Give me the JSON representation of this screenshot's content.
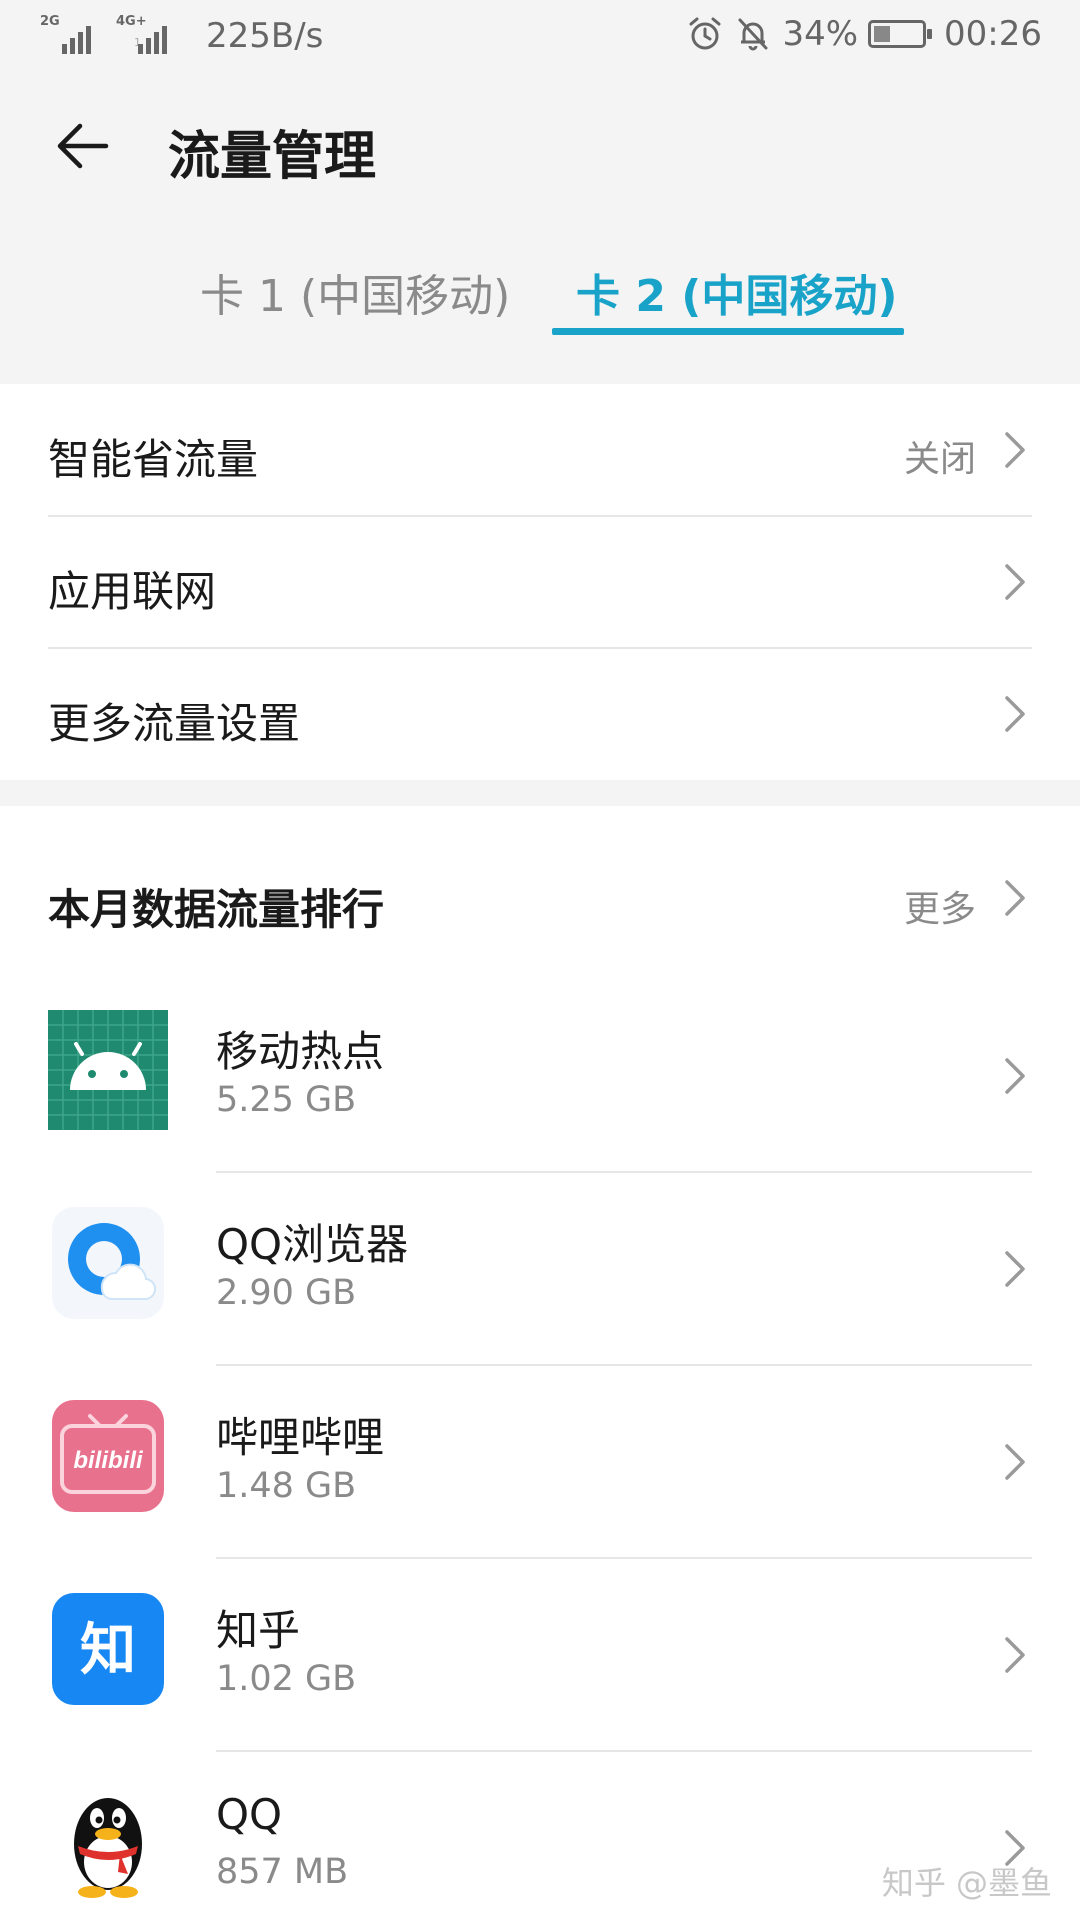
{
  "status_bar": {
    "network_1": "2G",
    "network_2": "4G+",
    "network_2_sub": "1",
    "speed": "225B/s",
    "battery_percent": "34%",
    "battery_level": 0.34,
    "time": "00:26",
    "icons": [
      "alarm-icon",
      "bell-off-icon",
      "battery-charging-icon"
    ]
  },
  "header": {
    "back_icon": "arrow-left-icon",
    "title": "流量管理"
  },
  "tabs": {
    "items": [
      {
        "label": "卡 1 (中国移动)",
        "selected": false
      },
      {
        "label": "卡 2 (中国移动)",
        "selected": true
      }
    ],
    "active_color": "#1aa3c8"
  },
  "settings": [
    {
      "label": "智能省流量",
      "value": "关闭"
    },
    {
      "label": "应用联网",
      "value": ""
    },
    {
      "label": "更多流量设置",
      "value": ""
    }
  ],
  "ranking": {
    "title": "本月数据流量排行",
    "more_label": "更多",
    "apps": [
      {
        "name": "移动热点",
        "size": "5.25 GB",
        "icon": "android-icon"
      },
      {
        "name": "QQ浏览器",
        "size": "2.90 GB",
        "icon": "qq-browser-icon"
      },
      {
        "name": "哔哩哔哩",
        "size": "1.48 GB",
        "icon": "bilibili-icon",
        "icon_text": "bilibili"
      },
      {
        "name": "知乎",
        "size": "1.02 GB",
        "icon": "zhihu-icon",
        "icon_text": "知"
      },
      {
        "name": "QQ",
        "size": "857 MB",
        "icon": "qq-penguin-icon"
      }
    ]
  },
  "watermark": "知乎 @墨鱼"
}
